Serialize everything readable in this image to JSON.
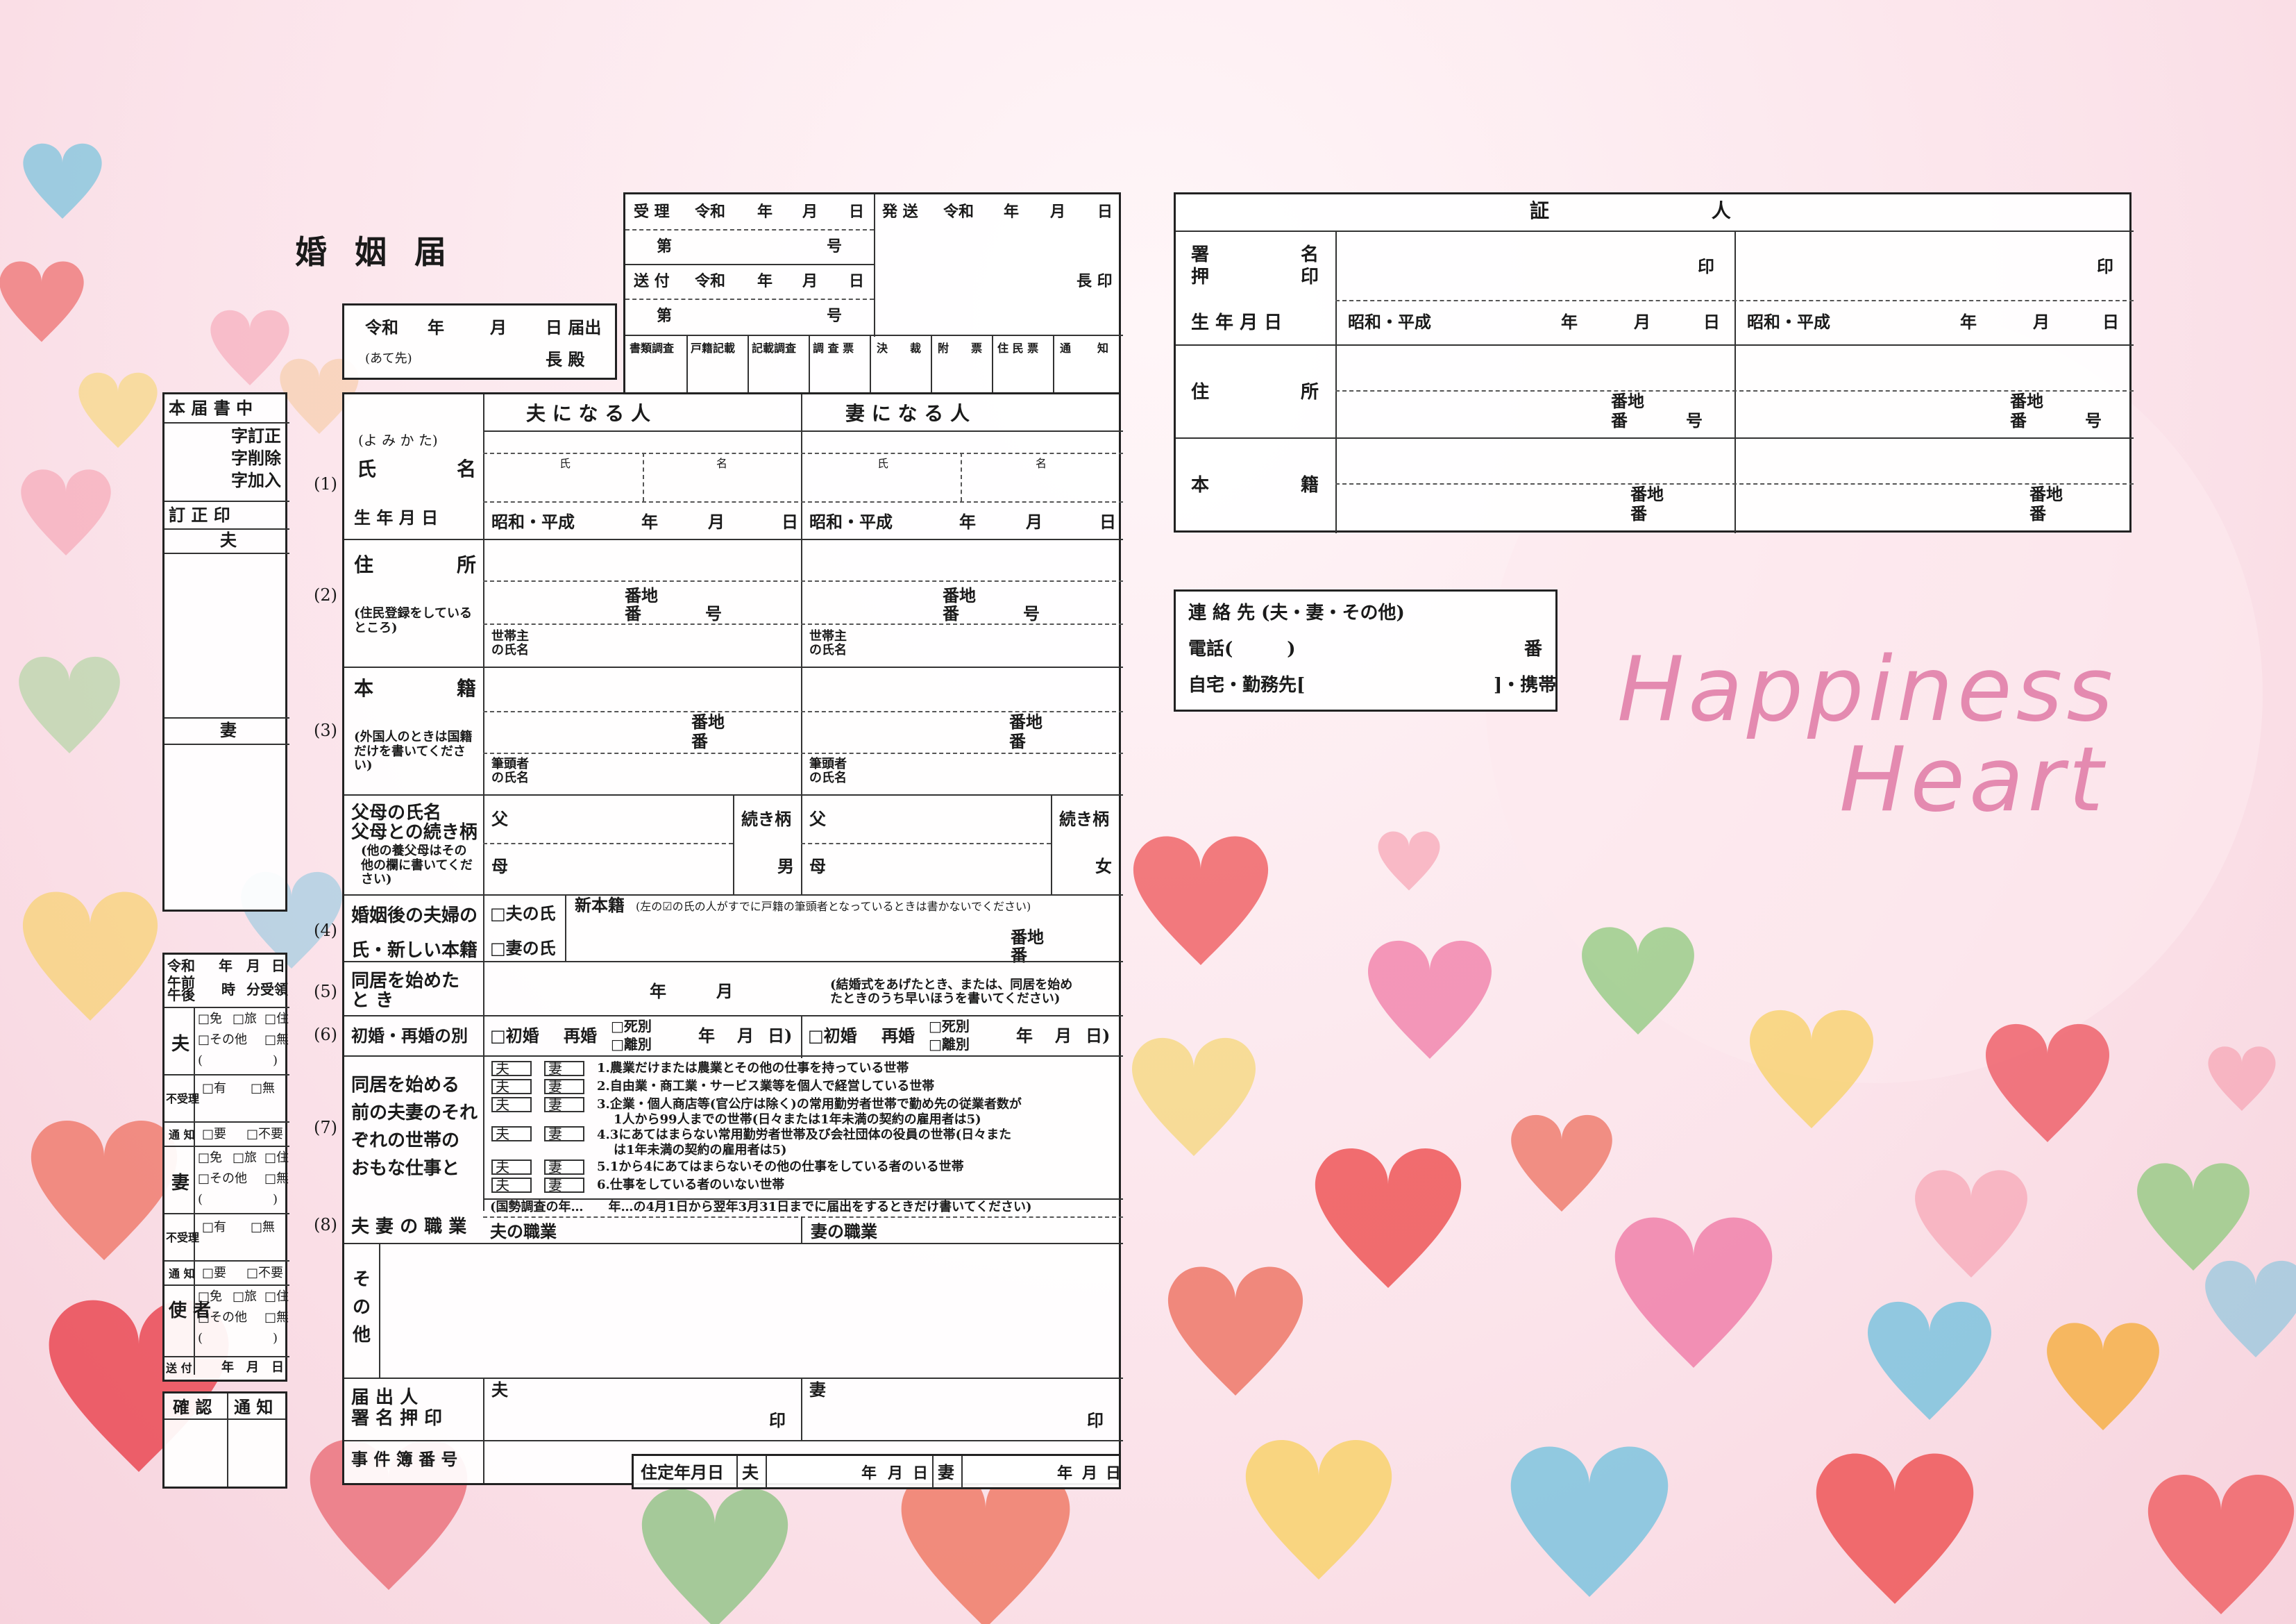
{
  "form_title": "婚 姻 届",
  "receipt": {
    "r1": [
      "受 理",
      "令和",
      "年",
      "月",
      "日",
      "発 送",
      "令和",
      "年",
      "月",
      "日"
    ],
    "r2": [
      "第",
      "号"
    ],
    "r3": [
      "送 付",
      "令和",
      "年",
      "月",
      "日",
      "長 印"
    ],
    "r4": [
      "第",
      "号"
    ],
    "cols": [
      "書類調査",
      "戸籍記載",
      "記載調査",
      "調 査 票",
      "決",
      "裁",
      "附",
      "票",
      "住 民 票",
      "通",
      "知"
    ]
  },
  "filing": {
    "date": [
      "令和",
      "年",
      "月",
      "日 届出"
    ],
    "to": "(あて先)",
    "chief": "長 殿"
  },
  "left_margin": {
    "title": "本 届 書 中",
    "items": [
      "字訂正",
      "字削除",
      "字加入"
    ],
    "seal": "訂 正 印",
    "husband": "夫",
    "wife": "妻",
    "check_rows": [
      "令和",
      "年",
      "月",
      "日",
      "午前",
      "午後",
      "時",
      "分受領"
    ],
    "opts_a": [
      "□免",
      "□旅",
      "□住",
      "□その他",
      "□無",
      "(",
      ")"
    ],
    "opts_b": [
      "□有",
      "□無"
    ],
    "opts_c": [
      "□要",
      "□不要"
    ],
    "labels": [
      "夫",
      "不受理",
      "通 知",
      "妻",
      "不受理",
      "通 知",
      "使 者",
      "送 付"
    ],
    "confirm": [
      "確 認",
      "通 知"
    ]
  },
  "main": {
    "husband_hdr": "夫 に な る 人",
    "wife_hdr": "妻 に な る 人",
    "reading": "(よ み か た)",
    "name": [
      "氏",
      "名"
    ],
    "surname": "氏",
    "given": "名",
    "birth": "生 年 月 日",
    "birth_val": [
      "昭和・平成",
      "年",
      "月",
      "日"
    ],
    "address": [
      "住",
      "所"
    ],
    "address_note": "(住民登録をしているところ)",
    "banchi": "番地",
    "ban": "番",
    "go": "号",
    "household_head": [
      "世帯主",
      "の氏名"
    ],
    "domicile": [
      "本",
      "籍"
    ],
    "domicile_note": "(外国人のときは国籍だけを書いてください)",
    "family_head": [
      "筆頭者",
      "の氏名"
    ],
    "parents": [
      "父母の氏名",
      "父母との続き柄"
    ],
    "parents_note": "(他の養父母はその他の欄に書いてください)",
    "father": "父",
    "mother": "母",
    "relation": "続き柄",
    "male": "男",
    "female": "女",
    "new_name": [
      "婚姻後の夫婦の",
      "氏・新しい本籍"
    ],
    "husband_surname": "□夫の氏",
    "wife_surname": "□妻の氏",
    "new_domicile": "新本籍",
    "new_domicile_note": "(左の☑の氏の人がすでに戸籍の筆頭者となっているときは書かないでください)",
    "cohabit": [
      "同居を始めた",
      "と き"
    ],
    "cohabit_val": [
      "年",
      "月"
    ],
    "cohabit_note": [
      "(結婚式をあげたとき、または、同居を始め",
      "たときのうち早いほうを書いてください)"
    ],
    "marriage_type": "初婚・再婚の別",
    "first": "□初婚",
    "re": "再婚",
    "death": "□死別",
    "divorce": "□離別",
    "ymd": [
      "年",
      "月",
      "日)"
    ],
    "occupation_section": [
      "同居を始める",
      "前の夫妻のそれ",
      "ぞれの世帯の",
      "おもな仕事と"
    ],
    "husband_s": "夫",
    "wife_s": "妻",
    "occ_items": [
      "1.農業だけまたは農業とその他の仕事を持っている世帯",
      "2.自由業・商工業・サービス業等を個人で経営している世帯",
      "3.企業・個人商店等(官公庁は除く)の常用勤労者世帯で勤め先の従業者数が",
      "1人から99人までの世帯(日々または1年未満の契約の雇用者は5)",
      "4.3にあてはまらない常用勤労者世帯及び会社団体の役員の世帯(日々また",
      "は1年未満の契約の雇用者は5)",
      "5.1から4にあてはまらないその他の仕事をしている者のいる世帯",
      "6.仕事をしている者のいない世帯"
    ],
    "job_label": "夫 妻 の 職 業",
    "job_note": "(国勢調査の年…　　年…の4月1日から翌年3月31日までに届出をするときだけ書いてください)",
    "husband_job": "夫の職業",
    "wife_job": "妻の職業",
    "other": [
      "そ",
      "の",
      "他"
    ],
    "signer": [
      "届 出 人",
      "署 名 押 印"
    ],
    "seal": "印",
    "case_no": "事 件 簿 番 号",
    "residence_date": "住定年月日",
    "nums": [
      "(1)",
      "(2)",
      "(3)",
      "(4)",
      "(5)",
      "(6)",
      "(7)",
      "(8)"
    ]
  },
  "witness": {
    "title": "証 　　　　　　　　人",
    "sign": [
      "署",
      "名",
      "押",
      "印"
    ],
    "seal": "印",
    "birth": "生 年 月 日",
    "birth_val": [
      "昭和・平成",
      "年",
      "月",
      "日"
    ],
    "address": [
      "住",
      "所"
    ],
    "domicile": [
      "本",
      "籍"
    ],
    "banchi": "番地",
    "ban": "番",
    "go": "号"
  },
  "contact": {
    "title": "連 絡 先 (夫・妻・その他)",
    "phone": "電話(　　　)",
    "ban": "番",
    "home": "自宅・勤務先[",
    "mobile": "]・携帯"
  },
  "decoration": {
    "line1": "Happiness",
    "line2": "Heart",
    "color": "#e07aa6"
  }
}
